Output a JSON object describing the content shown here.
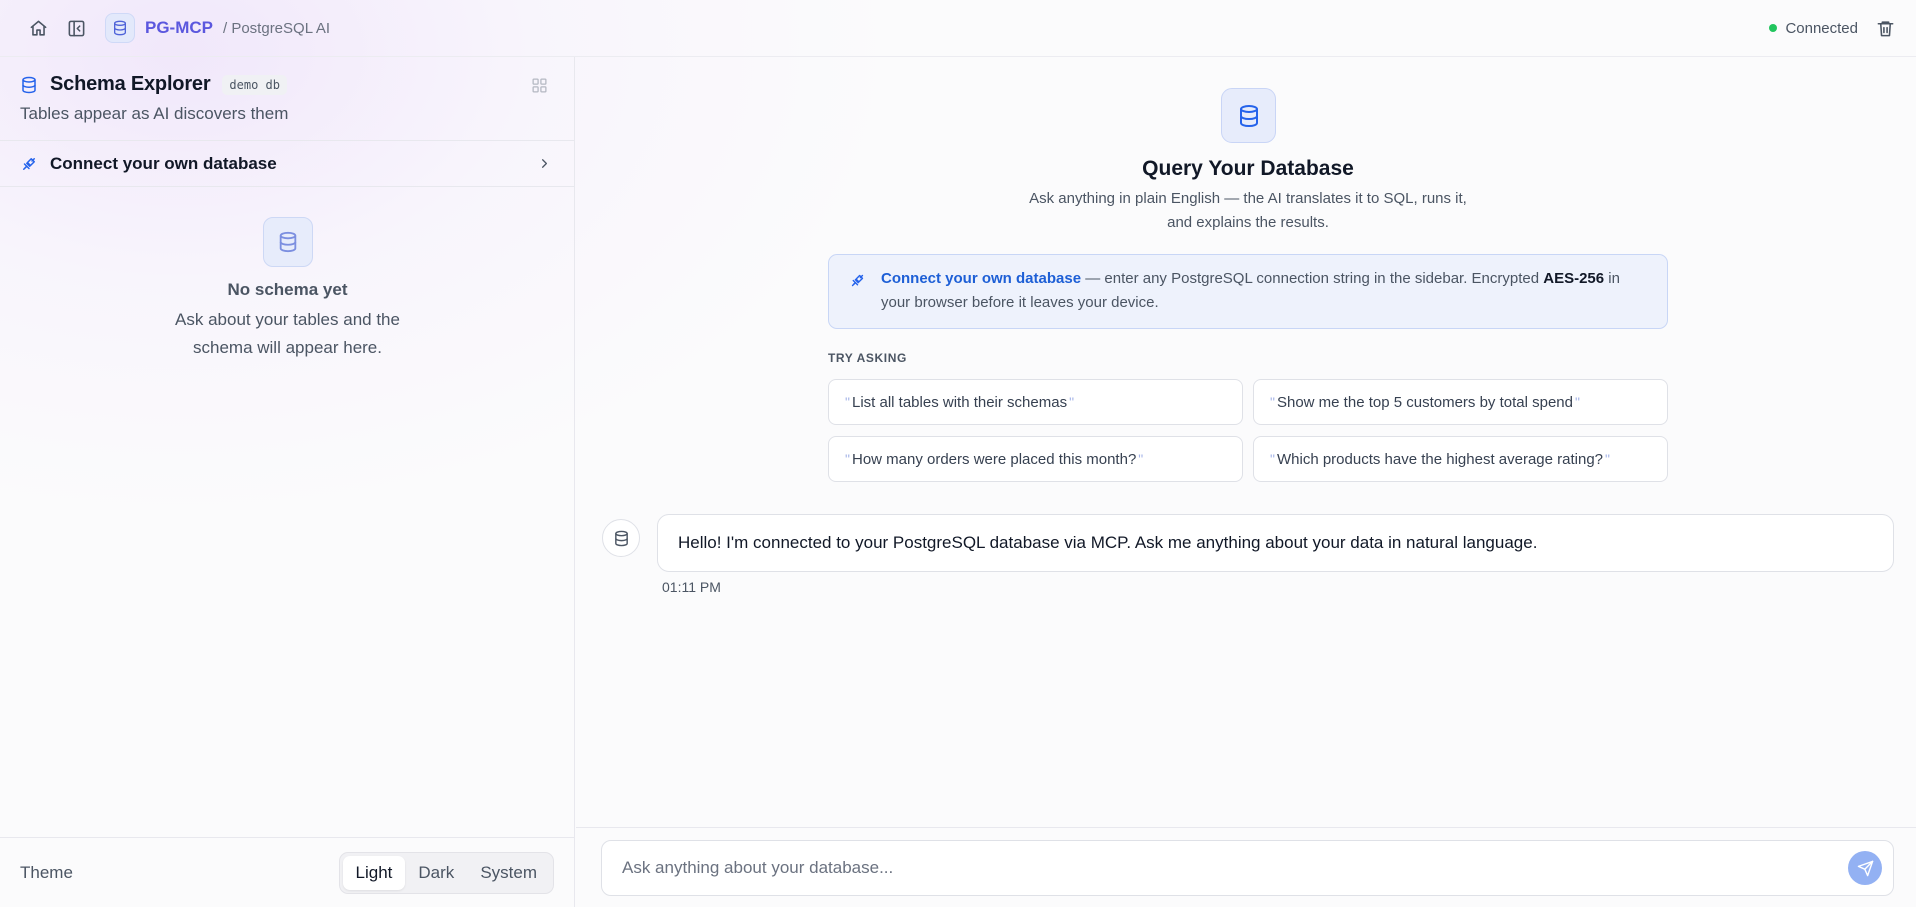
{
  "header": {
    "brand_name": "PG-MCP",
    "brand_sub": "/ PostgreSQL AI",
    "status": "Connected",
    "status_color": "#22c55e",
    "icons": [
      "home-icon",
      "collapse-sidebar-icon",
      "database-icon",
      "trash-icon"
    ]
  },
  "sidebar": {
    "title": "Schema Explorer",
    "badge": "demo db",
    "subtitle": "Tables appear as AI discovers them",
    "connect_label": "Connect your own database",
    "empty_title": "No schema yet",
    "empty_desc": "Ask about your tables and the schema will appear here.",
    "theme_label": "Theme",
    "theme_options": [
      "Light",
      "Dark",
      "System"
    ],
    "theme_selected": "Light"
  },
  "main": {
    "hero_title": "Query Your Database",
    "hero_desc_line1": "Ask anything in plain English — the AI translates it to SQL, runs it,",
    "hero_desc_line2": "and explains the results.",
    "notice": {
      "link": "Connect your own database",
      "text_before": " — enter any PostgreSQL connection string in the sidebar. Encrypted ",
      "strong": "AES-256",
      "text_after": " in your browser before it leaves your device."
    },
    "try_label": "TRY ASKING",
    "suggestions": [
      "List all tables with their schemas",
      "Show me the top 5 customers by total spend",
      "How many orders were placed this month?",
      "Which products have the highest average rating?"
    ],
    "message": {
      "text": "Hello! I'm connected to your PostgreSQL database via MCP. Ask me anything about your data in natural language.",
      "time": "01:11 PM"
    },
    "composer": {
      "placeholder": "Ask anything about your database...",
      "value": ""
    }
  },
  "colors": {
    "accent": "#2563eb",
    "brand": "#5b57de",
    "notice_bg": "#eef2fc",
    "send_button": "#93b1f3"
  }
}
